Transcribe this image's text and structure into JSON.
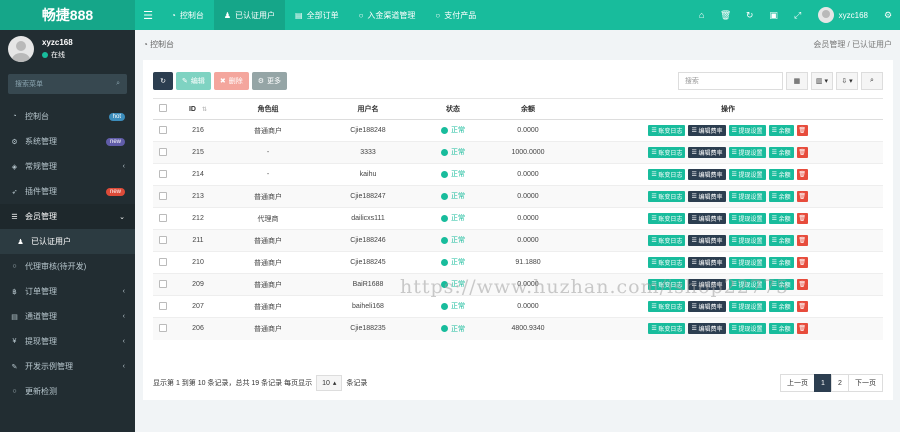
{
  "brand": {
    "name": "畅捷888"
  },
  "topnav": {
    "tabs": [
      {
        "icon": "tachometer-icon",
        "label": "控制台"
      },
      {
        "icon": "user-icon",
        "label": "已认证用户"
      },
      {
        "icon": "list-icon",
        "label": "全部订单"
      },
      {
        "icon": "circle-icon",
        "label": "入金渠道管理"
      },
      {
        "icon": "circle-icon",
        "label": "支付产品"
      }
    ],
    "user_name": "xyzc168"
  },
  "sidebar": {
    "user": {
      "name": "xyzc168",
      "status": "在线"
    },
    "search_placeholder": "搜索菜单",
    "items": [
      {
        "label": "控制台",
        "badge": "hot",
        "badge_color": "#3c8dbc"
      },
      {
        "label": "系统管理",
        "badge": "new",
        "badge_color": "#605ca8"
      },
      {
        "label": "常规管理"
      },
      {
        "label": "插件管理",
        "badge": "new",
        "badge_color": "#dd4b39"
      },
      {
        "label": "会员管理"
      },
      {
        "label": "已认证用户"
      },
      {
        "label": "代理审核(待开发)"
      },
      {
        "label": "订单管理"
      },
      {
        "label": "通道管理"
      },
      {
        "label": "提现管理"
      },
      {
        "label": "开发示例管理"
      },
      {
        "label": "更新检测"
      }
    ]
  },
  "breadcrumb": {
    "home": "控制台",
    "path": "会员管理 / 已认证用户"
  },
  "toolbar": {
    "edit": "编辑",
    "delete": "删除",
    "more": "更多",
    "search_placeholder": "搜索"
  },
  "table": {
    "headers": [
      "ID",
      "角色组",
      "用户名",
      "状态",
      "余额",
      "操作"
    ],
    "status_label": "正常",
    "op_labels": [
      "账变日志",
      "编辑费率",
      "提现设置",
      "余额"
    ],
    "rows": [
      {
        "id": "216",
        "role": "普通商户",
        "username": "Cjie188248",
        "balance": "0.0000"
      },
      {
        "id": "215",
        "role": "-",
        "username": "3333",
        "balance": "1000.0000"
      },
      {
        "id": "214",
        "role": "-",
        "username": "kaihu",
        "balance": "0.0000"
      },
      {
        "id": "213",
        "role": "普通商户",
        "username": "Cjie188247",
        "balance": "0.0000"
      },
      {
        "id": "212",
        "role": "代理商",
        "username": "dailicxs111",
        "balance": "0.0000"
      },
      {
        "id": "211",
        "role": "普通商户",
        "username": "Cjie188246",
        "balance": "0.0000"
      },
      {
        "id": "210",
        "role": "普通商户",
        "username": "Cjie188245",
        "balance": "91.1880"
      },
      {
        "id": "209",
        "role": "普通商户",
        "username": "BaiR1688",
        "balance": "0.0000"
      },
      {
        "id": "207",
        "role": "普通商户",
        "username": "baiheli168",
        "balance": "0.0000"
      },
      {
        "id": "206",
        "role": "普通商户",
        "username": "Cjie188235",
        "balance": "4800.9340"
      }
    ]
  },
  "footer": {
    "summary_before": "显示第 1 到第 10 条记录，总共 19 条记录 每页显示",
    "page_size": "10",
    "summary_after": "条记录",
    "prev": "上一页",
    "pages": [
      "1",
      "2"
    ],
    "next": "下一页"
  },
  "watermark": "https://www.huzhan.com/ishop22775",
  "colors": {
    "accent": "#18bc9c",
    "sidebar": "#222d32",
    "dark": "#2c3e50",
    "danger": "#e74c3c"
  }
}
